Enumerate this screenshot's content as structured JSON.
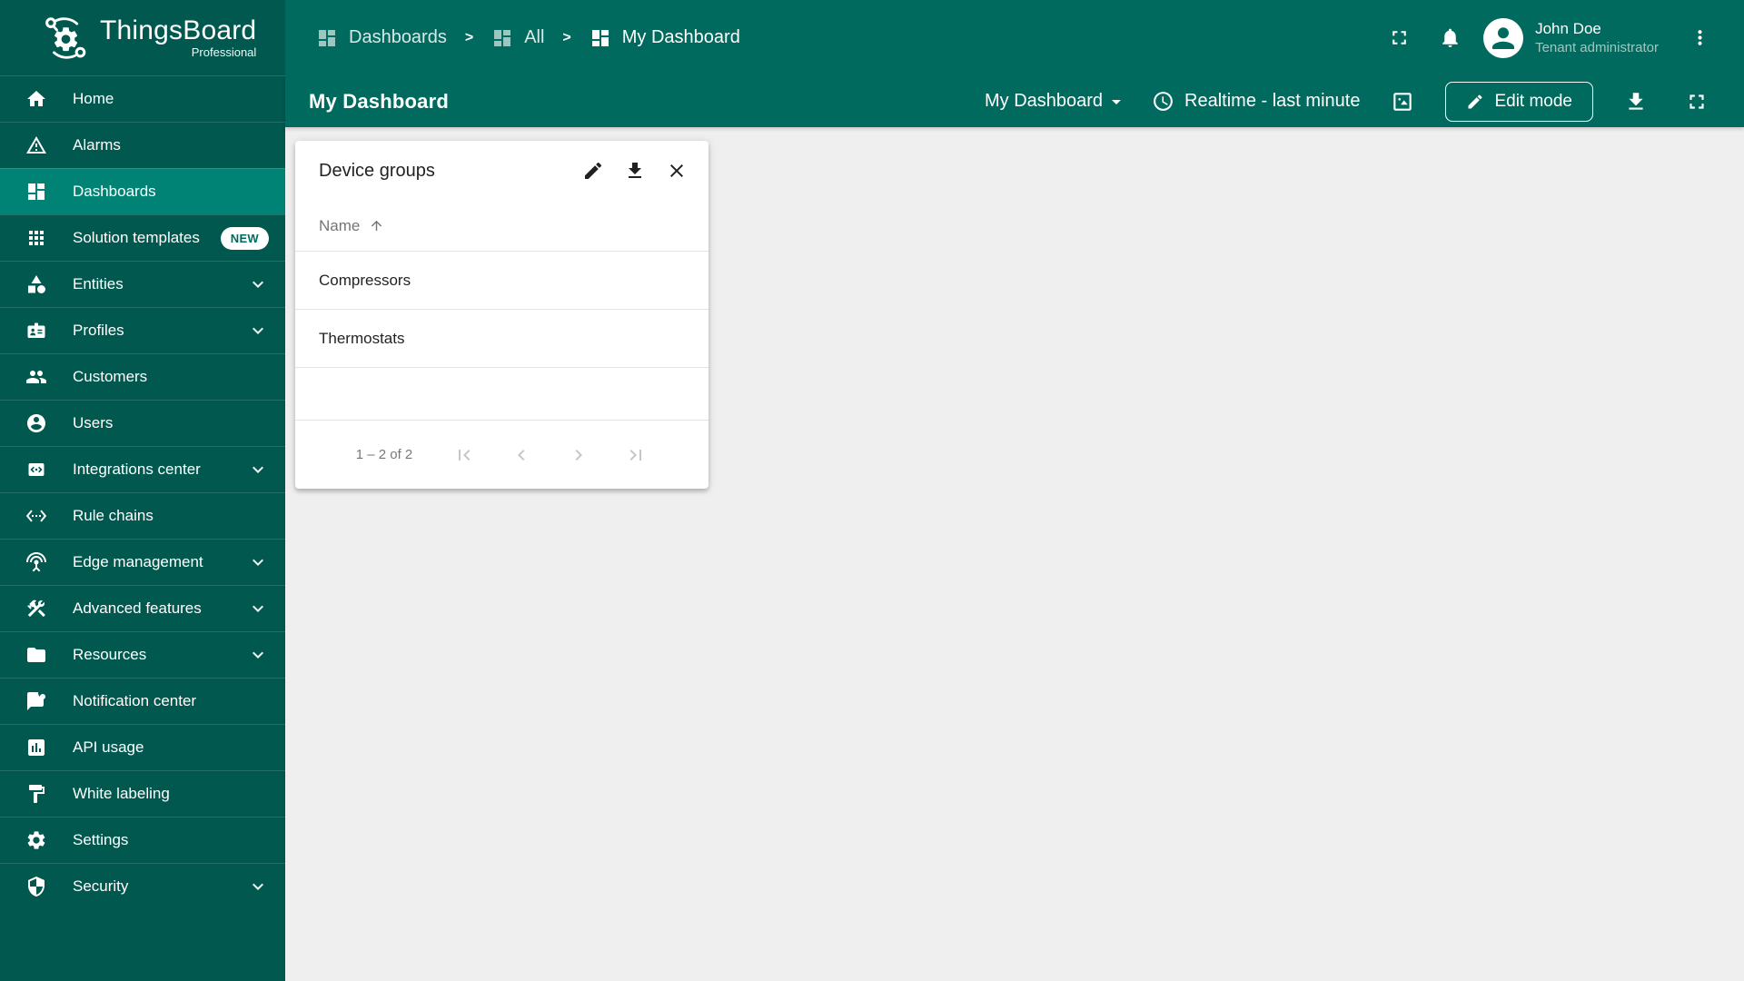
{
  "brand": {
    "name": "ThingsBoard",
    "edition": "Professional"
  },
  "colors": {
    "header": "#016A5E",
    "sidebar": "#00584F",
    "sidebar_selected": "#008374",
    "content_bg": "#EFEFEF",
    "badge_text": "#016A5E"
  },
  "sidebar": {
    "items": [
      {
        "id": "home",
        "label": "Home",
        "icon": "home",
        "selected": false,
        "expandable": false,
        "badge": ""
      },
      {
        "id": "alarms",
        "label": "Alarms",
        "icon": "warning",
        "selected": false,
        "expandable": false,
        "badge": ""
      },
      {
        "id": "dashboards",
        "label": "Dashboards",
        "icon": "dashboard",
        "selected": true,
        "expandable": false,
        "badge": ""
      },
      {
        "id": "solution-templates",
        "label": "Solution templates",
        "icon": "apps",
        "selected": false,
        "expandable": false,
        "badge": "NEW"
      },
      {
        "id": "entities",
        "label": "Entities",
        "icon": "category",
        "selected": false,
        "expandable": true,
        "badge": ""
      },
      {
        "id": "profiles",
        "label": "Profiles",
        "icon": "badge-id",
        "selected": false,
        "expandable": true,
        "badge": ""
      },
      {
        "id": "customers",
        "label": "Customers",
        "icon": "people",
        "selected": false,
        "expandable": false,
        "badge": ""
      },
      {
        "id": "users",
        "label": "Users",
        "icon": "account",
        "selected": false,
        "expandable": false,
        "badge": ""
      },
      {
        "id": "integrations-center",
        "label": "Integrations center",
        "icon": "integration",
        "selected": false,
        "expandable": true,
        "badge": ""
      },
      {
        "id": "rule-chains",
        "label": "Rule chains",
        "icon": "ethernet",
        "selected": false,
        "expandable": false,
        "badge": ""
      },
      {
        "id": "edge-management",
        "label": "Edge management",
        "icon": "antenna",
        "selected": false,
        "expandable": true,
        "badge": ""
      },
      {
        "id": "advanced-features",
        "label": "Advanced features",
        "icon": "construction",
        "selected": false,
        "expandable": true,
        "badge": ""
      },
      {
        "id": "resources",
        "label": "Resources",
        "icon": "folder",
        "selected": false,
        "expandable": true,
        "badge": ""
      },
      {
        "id": "notification-center",
        "label": "Notification center",
        "icon": "chat-dot",
        "selected": false,
        "expandable": false,
        "badge": ""
      },
      {
        "id": "api-usage",
        "label": "API usage",
        "icon": "chart-box",
        "selected": false,
        "expandable": false,
        "badge": ""
      },
      {
        "id": "white-labeling",
        "label": "White labeling",
        "icon": "paint",
        "selected": false,
        "expandable": false,
        "badge": ""
      },
      {
        "id": "settings",
        "label": "Settings",
        "icon": "gear",
        "selected": false,
        "expandable": false,
        "badge": ""
      },
      {
        "id": "security",
        "label": "Security",
        "icon": "shield",
        "selected": false,
        "expandable": true,
        "badge": ""
      }
    ]
  },
  "breadcrumb": {
    "separator": ">",
    "items": [
      {
        "id": "dashboards",
        "label": "Dashboards",
        "icon": "dashboard",
        "current": false
      },
      {
        "id": "all",
        "label": "All",
        "icon": "dashboard",
        "current": false
      },
      {
        "id": "my-dashboard",
        "label": "My Dashboard",
        "icon": "dashboard",
        "current": true
      }
    ]
  },
  "topbar": {
    "user": {
      "name": "John Doe",
      "role": "Tenant administrator"
    }
  },
  "toolbar": {
    "title": "My Dashboard",
    "state_select": "My Dashboard",
    "timewindow": "Realtime - last minute",
    "edit_button": "Edit mode"
  },
  "widget": {
    "title": "Device groups",
    "column": "Name",
    "rows": [
      "Compressors",
      "Thermostats"
    ],
    "paginator": {
      "range_label": "1 – 2 of 2"
    }
  }
}
